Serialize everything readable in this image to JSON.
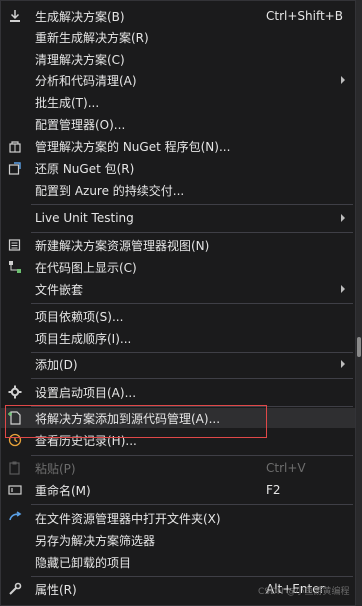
{
  "menu": {
    "items": [
      {
        "label": "生成解决方案(B)",
        "shortcut": "Ctrl+Shift+B",
        "icon": "build-icon"
      },
      {
        "label": "重新生成解决方案(R)"
      },
      {
        "label": "清理解决方案(C)"
      },
      {
        "label": "分析和代码清理(A)",
        "submenu": true
      },
      {
        "label": "批生成(T)..."
      },
      {
        "label": "配置管理器(O)..."
      },
      {
        "label": "管理解决方案的 NuGet 程序包(N)...",
        "icon": "nuget-icon"
      },
      {
        "label": "还原 NuGet 包(R)",
        "icon": "restore-icon"
      },
      {
        "label": "配置到 Azure 的持续交付..."
      },
      {
        "label": "Live Unit Testing",
        "submenu": true
      },
      {
        "label": "新建解决方案资源管理器视图(N)",
        "icon": "new-view-icon"
      },
      {
        "label": "在代码图上显示(C)",
        "icon": "code-map-icon"
      },
      {
        "label": "文件嵌套",
        "submenu": true
      },
      {
        "label": "项目依赖项(S)..."
      },
      {
        "label": "项目生成顺序(I)..."
      },
      {
        "label": "添加(D)",
        "submenu": true
      },
      {
        "label": "设置启动项目(A)...",
        "icon": "gear-icon"
      },
      {
        "label": "将解决方案添加到源代码管理(A)...",
        "icon": "add-source-control-icon"
      },
      {
        "label": "查看历史记录(H)...",
        "icon": "history-icon"
      },
      {
        "label": "粘贴(P)",
        "shortcut": "Ctrl+V",
        "icon": "paste-icon",
        "disabled": true
      },
      {
        "label": "重命名(M)",
        "shortcut": "F2",
        "icon": "rename-icon"
      },
      {
        "label": "在文件资源管理器中打开文件夹(X)",
        "icon": "open-folder-icon"
      },
      {
        "label": "另存为解决方案筛选器"
      },
      {
        "label": "隐藏已卸载的项目"
      },
      {
        "label": "属性(R)",
        "shortcut": "Alt+Enter",
        "icon": "wrench-icon"
      }
    ]
  },
  "watermark": "CSDN @小鱼游黄编程",
  "colors": {
    "background": "#1b1b1c",
    "highlight_box": "#e04848",
    "text": "#e6e6e6"
  }
}
